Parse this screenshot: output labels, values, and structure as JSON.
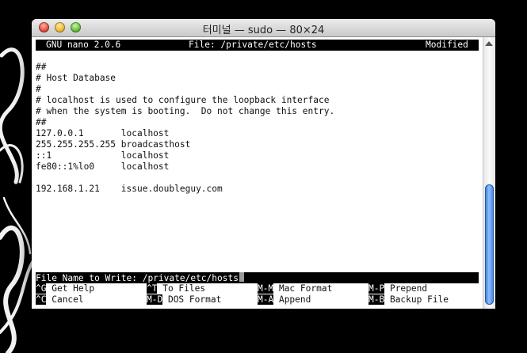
{
  "window": {
    "title": "터미널 — sudo — 80×24"
  },
  "nano": {
    "header": {
      "app": "GNU nano 2.0.6",
      "file": "File: /private/etc/hosts",
      "status": "Modified"
    },
    "content_lines": [
      "",
      "##",
      "# Host Database",
      "#",
      "# localhost is used to configure the loopback interface",
      "# when the system is booting.  Do not change this entry.",
      "##",
      "127.0.0.1       localhost",
      "255.255.255.255 broadcasthost",
      "::1             localhost",
      "fe80::1%lo0     localhost",
      "",
      "192.168.1.21    issue.doubleguy.com"
    ],
    "prompt": "File Name to Write: /private/etc/hosts",
    "shortcuts": [
      {
        "key": "^G",
        "label": " Get Help"
      },
      {
        "key": "^T",
        "label": " To Files"
      },
      {
        "key": "M-M",
        "label": " Mac Format"
      },
      {
        "key": "M-P",
        "label": " Prepend"
      },
      {
        "key": "^C",
        "label": " Cancel"
      },
      {
        "key": "M-D",
        "label": " DOS Format"
      },
      {
        "key": "M-A",
        "label": " Append"
      },
      {
        "key": "M-B",
        "label": " Backup File"
      }
    ]
  },
  "colors": {
    "desktop_background": "#000000",
    "terminal_background": "#ffffff",
    "scroll_thumb": "#3b7fdd"
  }
}
